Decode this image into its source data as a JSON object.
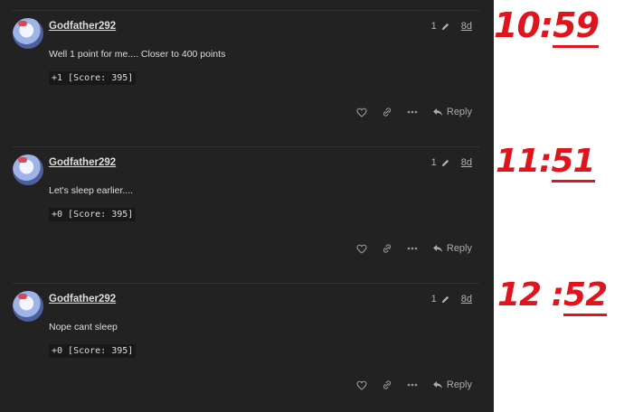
{
  "posts": [
    {
      "username": "Godfather292",
      "edit_count": "1",
      "age": "8d",
      "text": "Well 1 point for me.... Closer to 400 points",
      "score": "+1 [Score: 395]",
      "reply_label": "Reply",
      "annotation": {
        "hours": "10:",
        "minutes": "59"
      }
    },
    {
      "username": "Godfather292",
      "edit_count": "1",
      "age": "8d",
      "text": "Let's sleep earlier....",
      "score": "+0 [Score: 395]",
      "reply_label": "Reply",
      "annotation": {
        "hours": "11:",
        "minutes": "51"
      }
    },
    {
      "username": "Godfather292",
      "edit_count": "1",
      "age": "8d",
      "text": "Nope cant sleep",
      "score": "+0 [Score: 395]",
      "reply_label": "Reply",
      "annotation": {
        "hours": "12 :",
        "minutes": "52"
      }
    }
  ],
  "icons": {
    "edit": "pencil-icon",
    "like": "heart-icon",
    "link": "link-icon",
    "more": "ellipsis-icon",
    "reply": "reply-arrow-icon"
  },
  "colors": {
    "background": "#222222",
    "annotation": "#e0141c"
  }
}
